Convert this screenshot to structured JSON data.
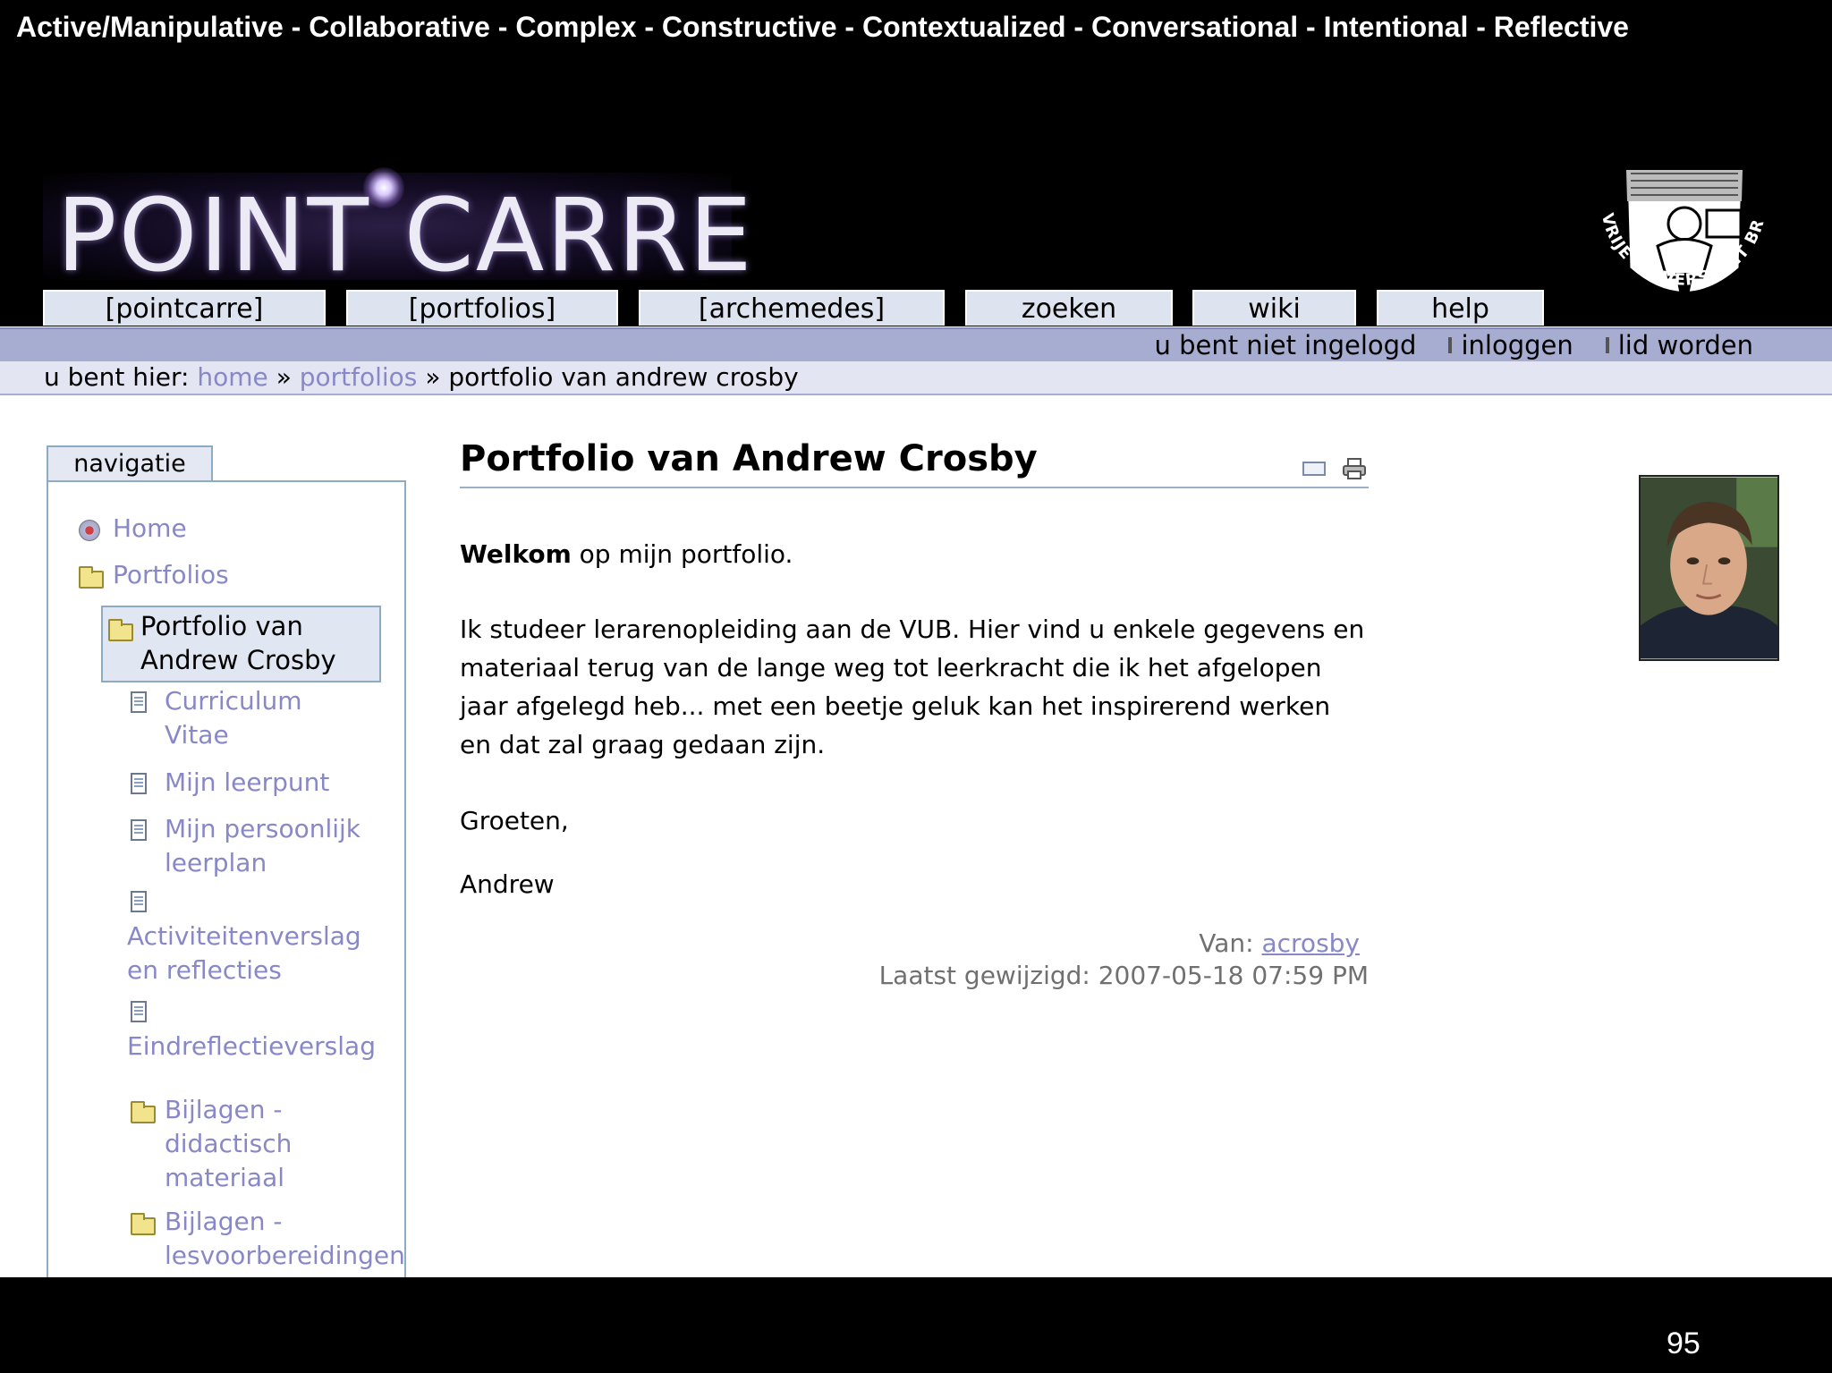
{
  "slide": {
    "header": "Active/Manipulative - Collaborative - Complex - Constructive - Contextualized - Conversational - Intentional - Reflective",
    "page_number": "95"
  },
  "site": {
    "logo_text": "POINT CARRE",
    "seal_text": "VRIJE UNIVERSITEIT BRUSSEL • SCIENTIA VINCERE TENEBRAS •",
    "tabs": [
      "[pointcarre]",
      "[portfolios]",
      "[archemedes]",
      "zoeken",
      "wiki",
      "help"
    ],
    "user_status": "u bent niet ingelogd",
    "login_label": "inloggen",
    "register_label": "lid worden"
  },
  "breadcrumb": {
    "prefix": "u bent hier:",
    "home": "home",
    "sep": "»",
    "portfolios": "portfolios",
    "current": "portfolio van andrew crosby"
  },
  "navigation": {
    "title": "navigatie",
    "items": [
      {
        "label": "Home",
        "icon": "home-icon"
      },
      {
        "label": "Portfolios",
        "icon": "folder-icon"
      },
      {
        "label": "Portfolio van\nAndrew Crosby",
        "icon": "folder-icon"
      },
      {
        "label": "Curriculum\nVitae",
        "icon": "document-icon"
      },
      {
        "label": "Mijn leerpunt",
        "icon": "document-icon"
      },
      {
        "label": "Mijn persoonlijk\nleerplan",
        "icon": "document-icon"
      },
      {
        "label": "Activiteitenverslag\nen reflecties",
        "icon": "document-icon"
      },
      {
        "label": "Eindreflectieverslag",
        "icon": "document-icon"
      },
      {
        "label": "Bijlagen -\ndidactisch\nmateriaal",
        "icon": "folder-icon"
      },
      {
        "label": "Bijlagen -\nlesvoorbereidingen",
        "icon": "folder-icon"
      }
    ]
  },
  "document": {
    "title": "Portfolio van Andrew Crosby",
    "welcome_bold": "Welkom",
    "welcome_rest": " op mijn portfolio.",
    "body": "Ik studeer lerarenopleiding aan de VUB. Hier vind u enkele gegevens en materiaal terug van de lange weg tot leerkracht die ik het afgelopen jaar afgelegd heb... met een beetje geluk kan het inspirerend werken en dat zal graag gedaan zijn.",
    "greeting": "Groeten,",
    "signature": "Andrew",
    "author_label": "Van:",
    "author": "acrosby",
    "modified": "Laatst gewijzigd: 2007-05-18 07:59 PM"
  },
  "colors": {
    "link": "#8888c8",
    "userbar": "#a7add0",
    "crumbbar": "#e3e5f2",
    "tab": "#dde3ef",
    "portlet_border": "#8eabc4"
  }
}
